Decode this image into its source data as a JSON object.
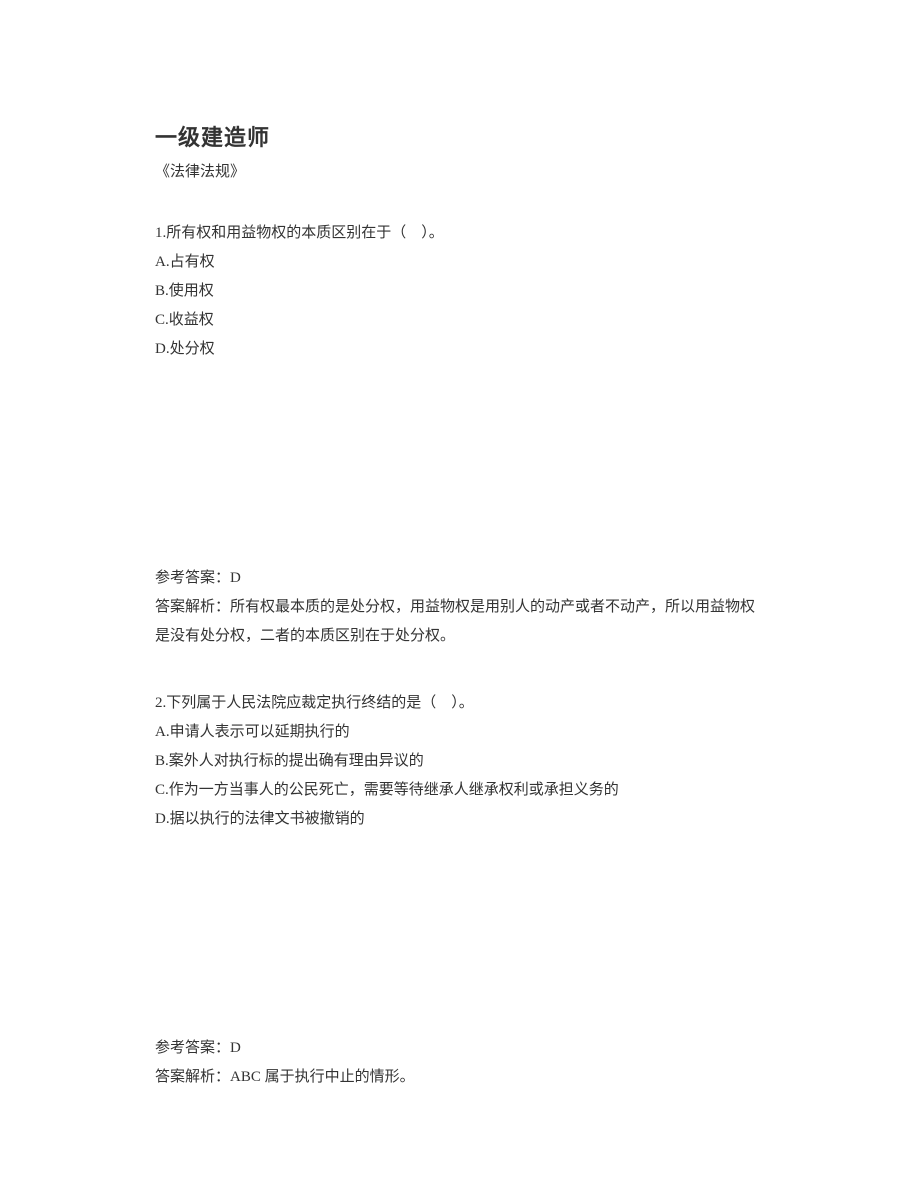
{
  "title": "一级建造师",
  "subtitle": "《法律法规》",
  "question1": {
    "number": "1.",
    "text": "所有权和用益物权的本质区别在于（　）。",
    "options": {
      "A": "A.占有权",
      "B": "B.使用权",
      "C": "C.收益权",
      "D": "D.处分权"
    }
  },
  "answer1": {
    "reference_label": "参考答案：",
    "reference_value": "D",
    "explanation_label": "答案解析：",
    "explanation_text": "所有权最本质的是处分权，用益物权是用别人的动产或者不动产，所以用益物权是没有处分权，二者的本质区别在于处分权。"
  },
  "question2": {
    "number": "2.",
    "text": "下列属于人民法院应裁定执行终结的是（　）。",
    "options": {
      "A": "A.申请人表示可以延期执行的",
      "B": "B.案外人对执行标的提出确有理由异议的",
      "C": "C.作为一方当事人的公民死亡，需要等待继承人继承权利或承担义务的",
      "D": "D.据以执行的法律文书被撤销的"
    }
  },
  "answer2": {
    "reference_label": "参考答案：",
    "reference_value": "D",
    "explanation_label": "答案解析：",
    "explanation_text": "ABC 属于执行中止的情形。"
  }
}
